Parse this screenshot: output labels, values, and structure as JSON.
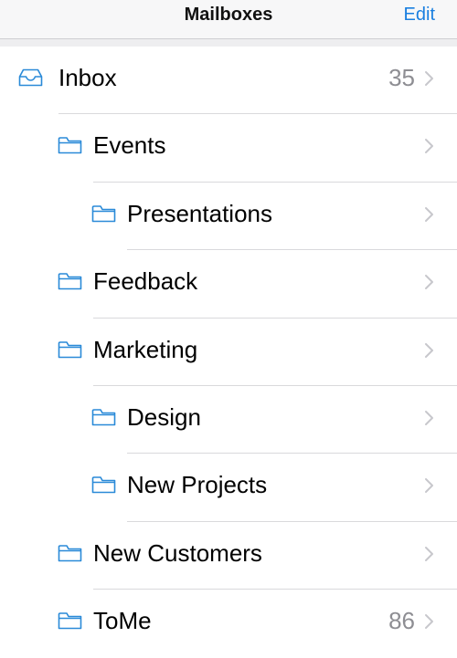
{
  "header": {
    "title": "Mailboxes",
    "edit_label": "Edit"
  },
  "colors": {
    "accent": "#1a7fe0",
    "icon": "#2a8ad8",
    "count": "#8e8e93",
    "chevron": "#c7c7cc"
  },
  "mailboxes": [
    {
      "label": "Inbox",
      "count": "35",
      "icon": "inbox-tray-icon",
      "level": 0
    },
    {
      "label": "Events",
      "count": "",
      "icon": "folder-icon",
      "level": 1
    },
    {
      "label": "Presentations",
      "count": "",
      "icon": "folder-icon",
      "level": 2
    },
    {
      "label": "Feedback",
      "count": "",
      "icon": "folder-icon",
      "level": 1
    },
    {
      "label": "Marketing",
      "count": "",
      "icon": "folder-icon",
      "level": 1
    },
    {
      "label": "Design",
      "count": "",
      "icon": "folder-icon",
      "level": 2
    },
    {
      "label": "New Projects",
      "count": "",
      "icon": "folder-icon",
      "level": 2
    },
    {
      "label": "New Customers",
      "count": "",
      "icon": "folder-icon",
      "level": 1
    },
    {
      "label": "ToMe",
      "count": "86",
      "icon": "folder-icon",
      "level": 1
    }
  ]
}
